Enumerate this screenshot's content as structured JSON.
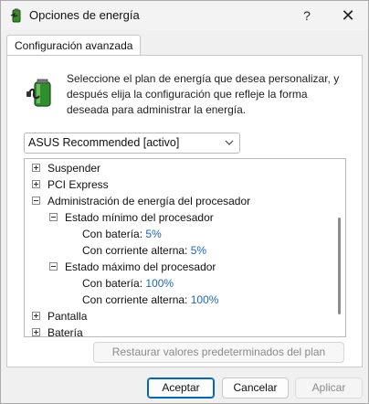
{
  "window": {
    "title": "Opciones de energía",
    "help_label": "?",
    "close_label": "✕"
  },
  "tab": {
    "label": "Configuración avanzada"
  },
  "description": "Seleccione el plan de energía que desea personalizar, y después elija la configuración que refleje la forma deseada para administrar la energía.",
  "plan_select": {
    "value": "ASUS Recommended [activo]"
  },
  "tree": {
    "suspend": "Suspender",
    "pci": "PCI Express",
    "cpu_mgmt": "Administración de energía del procesador",
    "min_state": "Estado mínimo del procesador",
    "min_battery_label": "Con batería:",
    "min_battery_value": "5%",
    "min_ac_label": "Con corriente alterna:",
    "min_ac_value": "5%",
    "max_state": "Estado máximo del procesador",
    "max_battery_label": "Con batería:",
    "max_battery_value": "100%",
    "max_ac_label": "Con corriente alterna:",
    "max_ac_value": "100%",
    "display": "Pantalla",
    "battery": "Batería"
  },
  "buttons": {
    "restore": "Restaurar valores predeterminados del plan",
    "ok": "Aceptar",
    "cancel": "Cancelar",
    "apply": "Aplicar"
  }
}
